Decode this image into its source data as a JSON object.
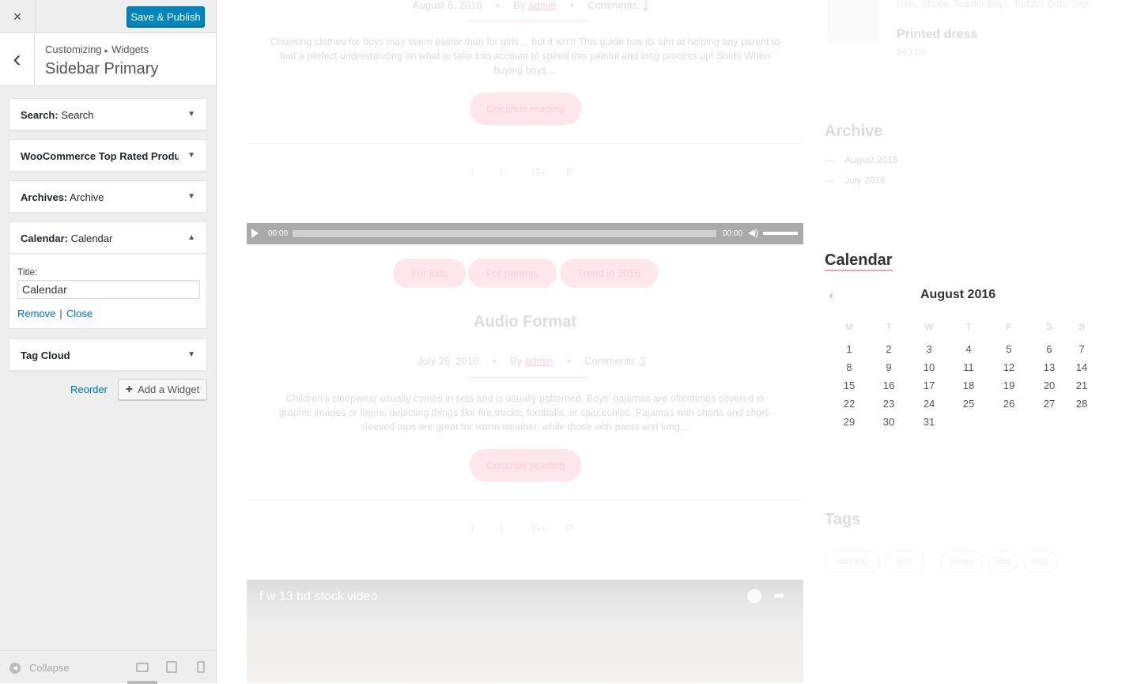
{
  "panel": {
    "close_icon": "×",
    "publish_label": "Save & Publish",
    "back_icon": "‹",
    "breadcrumb": [
      "Customizing",
      "Widgets"
    ],
    "breadcrumb_sep": "▸",
    "title": "Sidebar Primary",
    "widgets": [
      {
        "type": "Search:",
        "name": "Search"
      },
      {
        "type": "WooCommerce Top Rated Produ...",
        "name": ""
      },
      {
        "type": "Archives:",
        "name": "Archive"
      },
      {
        "type": "Calendar:",
        "name": "Calendar"
      },
      {
        "type": "Tag Cloud",
        "name": ""
      }
    ],
    "calendar_form": {
      "title_label": "Title:",
      "title_value": "Calendar",
      "remove_label": "Remove",
      "sep": "|",
      "close_label": "Close"
    },
    "reorder_label": "Reorder",
    "add_widget_label": "Add a Widget",
    "collapse_label": "Collapse"
  },
  "preview": {
    "post1": {
      "date": "August 6, 2016",
      "by": "By",
      "author": "admin",
      "comments_label": "Comments:",
      "comments": "1",
      "excerpt": "Choosing clothes for boys may seem easier than for girls… but it isn't! This guide has its aim at helping any parent to find a perfect understanding on what to take into account to speed this painful and long process up! Shirts When buying boys…",
      "read_more": "Continue reading"
    },
    "audio": {
      "time_start": "00:00",
      "time_end": "00:00"
    },
    "tags_row": [
      "For kids",
      "For parents",
      "Trend in 2016"
    ],
    "post2": {
      "title": "Audio Format",
      "date": "July 26, 2016",
      "by": "By",
      "author": "admin",
      "comments_label": "Comments:",
      "comments": "3",
      "excerpt": "Children's sleepwear usually comes in sets and is usually patterned. Boys' pajamas are oftentimes covered in graphic images or logos, depicting things like fire trucks, footballs, or spaceships. Pajamas with shorts and short-sleeved tops are great for warm weather, while those with pants and long…",
      "read_more": "Continue reading"
    },
    "video_title": "f w 13 hd stock video",
    "sidebar": {
      "product_cats": "Girls, Shoes, Toddler Boys, Toddler Girls, Toys",
      "product_name": "Printed dress",
      "product_price": "$43.00",
      "archive_title": "Archive",
      "archive_items": [
        "August 2016",
        "July 2016"
      ],
      "calendar_title": "Calendar",
      "calendar_month": "August 2016",
      "calendar_prev": "‹",
      "weekdays": [
        "M",
        "T",
        "W",
        "T",
        "F",
        "S",
        "S"
      ],
      "days": [
        "1",
        "2",
        "3",
        "4",
        "5",
        "6",
        "7",
        "8",
        "9",
        "10",
        "11",
        "12",
        "13",
        "14",
        "15",
        "16",
        "17",
        "18",
        "19",
        "20",
        "21",
        "22",
        "23",
        "24",
        "25",
        "26",
        "27",
        "28",
        "29",
        "30",
        "31"
      ],
      "tags_title": "Tags",
      "tags": [
        "clothing",
        "girls",
        "shoes",
        "Tips",
        "toys"
      ]
    }
  }
}
